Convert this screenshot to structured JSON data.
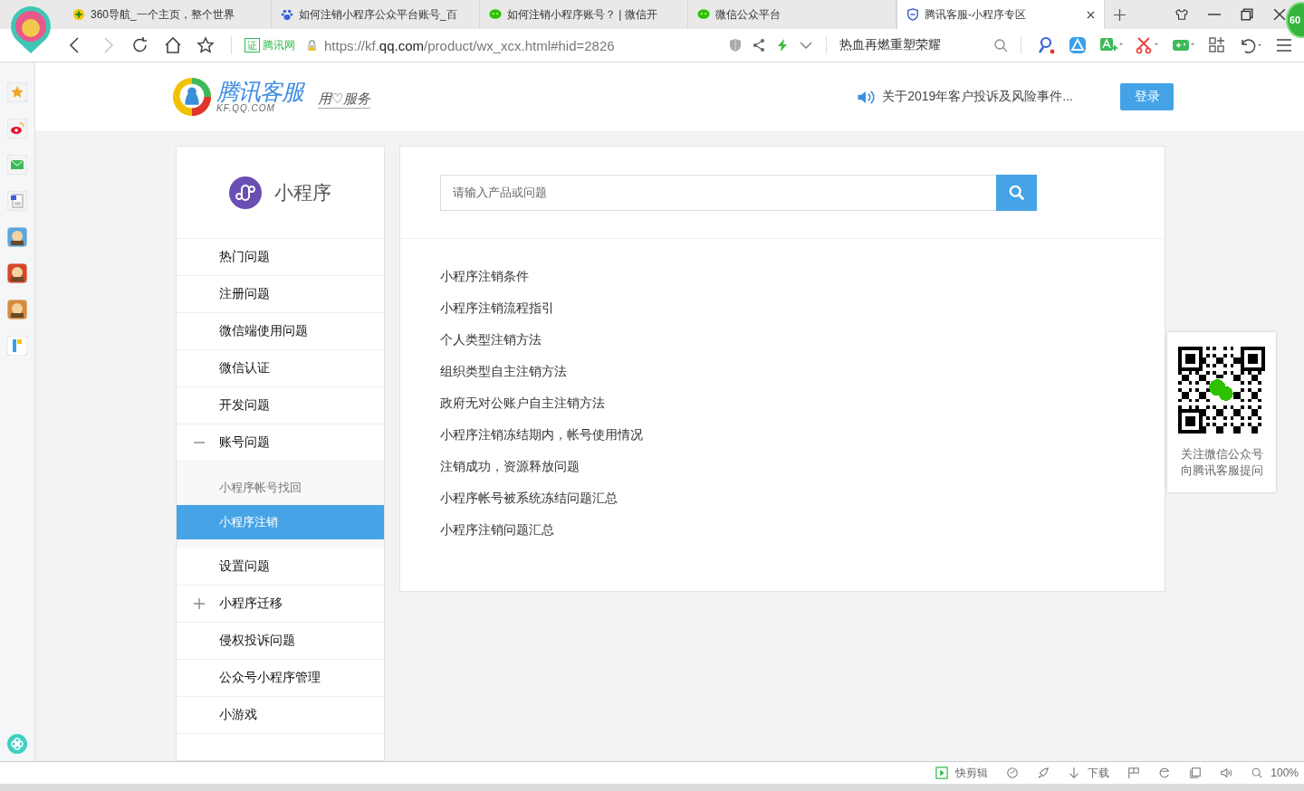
{
  "browser": {
    "tabs": [
      {
        "title": "360导航_一个主页，整个世界",
        "selected": false
      },
      {
        "title": "如何注销小程序公众平台账号_百",
        "selected": false
      },
      {
        "title": "如何注销小程序账号？ | 微信开",
        "selected": false
      },
      {
        "title": "微信公众平台",
        "selected": false
      },
      {
        "title": "腾讯客服-小程序专区",
        "selected": true
      }
    ],
    "nav_buttons": [
      {
        "kind": "back",
        "disabled": false
      },
      {
        "kind": "forward",
        "disabled": true
      },
      {
        "kind": "reload",
        "disabled": false
      },
      {
        "kind": "home",
        "disabled": false
      },
      {
        "kind": "star",
        "disabled": false
      }
    ],
    "address": {
      "badge": "证",
      "site": "腾讯网",
      "url": [
        {
          "text": "https://kf.",
          "strong": false
        },
        {
          "text": "qq.com",
          "strong": true
        },
        {
          "text": "/product/wx_xcx.html#hid=2826",
          "strong": false
        }
      ]
    },
    "search_hint": "热血再燃重塑荣耀",
    "profile_badge": "60"
  },
  "site_header": {
    "logo_title": "腾讯客服",
    "logo_subtitle": "KF.QQ.COM",
    "slogan": "用♡服务",
    "notice": "关于2019年客户投诉及风险事件...",
    "login": "登录"
  },
  "category": {
    "title": "小程序",
    "items": [
      {
        "label": "热门问题",
        "kind": "plain"
      },
      {
        "label": "注册问题",
        "kind": "plain"
      },
      {
        "label": "微信端使用问题",
        "kind": "plain"
      },
      {
        "label": "微信认证",
        "kind": "plain"
      },
      {
        "label": "开发问题",
        "kind": "plain"
      },
      {
        "label": "账号问题",
        "kind": "group",
        "expanded": true,
        "children": [
          {
            "label": "小程序帐号找回",
            "selected": false
          },
          {
            "label": "小程序注销",
            "selected": true
          }
        ]
      },
      {
        "label": "设置问题",
        "kind": "plain"
      },
      {
        "label": "小程序迁移",
        "kind": "group",
        "expanded": false
      },
      {
        "label": "侵权投诉问题",
        "kind": "plain"
      },
      {
        "label": "公众号小程序管理",
        "kind": "plain"
      },
      {
        "label": "小游戏",
        "kind": "plain"
      }
    ]
  },
  "search": {
    "placeholder": "请输入产品或问题"
  },
  "articles": [
    "小程序注销条件",
    "小程序注销流程指引",
    "个人类型注销方法",
    "组织类型自主注销方法",
    "政府无对公账户自主注销方法",
    "小程序注销冻结期内，帐号使用情况",
    "注销成功，资源释放问题",
    "小程序帐号被系统冻结问题汇总",
    "小程序注销问题汇总"
  ],
  "qr_card": {
    "caption": [
      "关注微信公众号",
      "向腾讯客服提问"
    ]
  },
  "status_bar": {
    "items": [
      {
        "kind": "clip",
        "label": "快剪辑"
      },
      {
        "kind": "speed"
      },
      {
        "kind": "pin"
      },
      {
        "kind": "download",
        "label": "下载"
      },
      {
        "kind": "flag"
      },
      {
        "kind": "ie"
      },
      {
        "kind": "window"
      },
      {
        "kind": "sound"
      },
      {
        "kind": "zoom",
        "label": "100%"
      }
    ]
  }
}
